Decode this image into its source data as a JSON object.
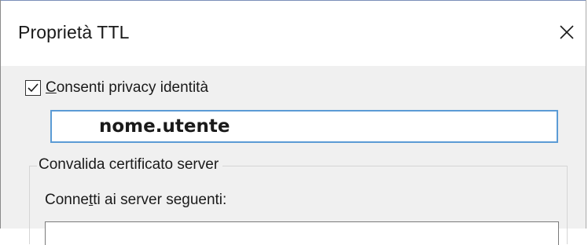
{
  "window": {
    "title": "Proprietà TTL",
    "close_glyph": "close-icon"
  },
  "identity_privacy": {
    "checked": true,
    "label_prefix": "",
    "label_accel": "C",
    "label_rest": "onsenti privacy identità",
    "value": "nome.utente"
  },
  "server_validation": {
    "legend": "Convalida certificato server",
    "connect_label_prefix": "Conne",
    "connect_label_accel": "t",
    "connect_label_rest": "ti ai server seguenti:",
    "servers_value": ""
  },
  "colors": {
    "focus_border": "#5b9bd5",
    "dialog_bg": "#f0f0f0"
  }
}
